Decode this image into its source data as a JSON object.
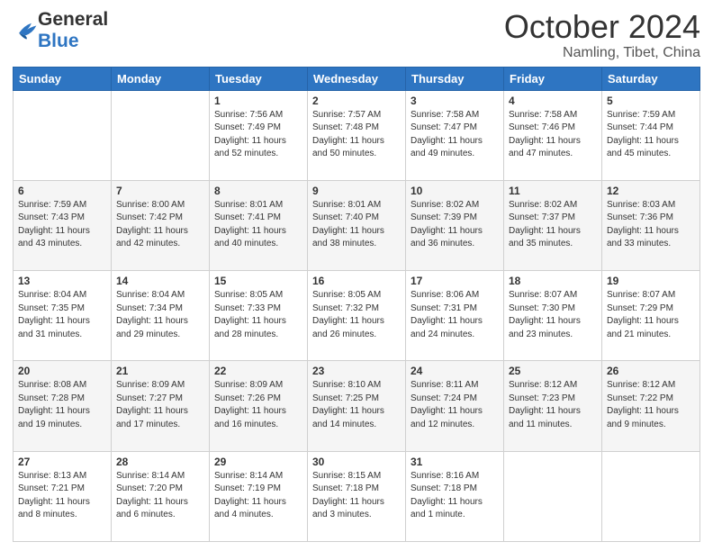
{
  "header": {
    "logo_line1": "General",
    "logo_line2": "Blue",
    "title": "October 2024",
    "location": "Namling, Tibet, China"
  },
  "weekdays": [
    "Sunday",
    "Monday",
    "Tuesday",
    "Wednesday",
    "Thursday",
    "Friday",
    "Saturday"
  ],
  "weeks": [
    [
      {
        "day": "",
        "sunrise": "",
        "sunset": "",
        "daylight": ""
      },
      {
        "day": "",
        "sunrise": "",
        "sunset": "",
        "daylight": ""
      },
      {
        "day": "1",
        "sunrise": "Sunrise: 7:56 AM",
        "sunset": "Sunset: 7:49 PM",
        "daylight": "Daylight: 11 hours and 52 minutes."
      },
      {
        "day": "2",
        "sunrise": "Sunrise: 7:57 AM",
        "sunset": "Sunset: 7:48 PM",
        "daylight": "Daylight: 11 hours and 50 minutes."
      },
      {
        "day": "3",
        "sunrise": "Sunrise: 7:58 AM",
        "sunset": "Sunset: 7:47 PM",
        "daylight": "Daylight: 11 hours and 49 minutes."
      },
      {
        "day": "4",
        "sunrise": "Sunrise: 7:58 AM",
        "sunset": "Sunset: 7:46 PM",
        "daylight": "Daylight: 11 hours and 47 minutes."
      },
      {
        "day": "5",
        "sunrise": "Sunrise: 7:59 AM",
        "sunset": "Sunset: 7:44 PM",
        "daylight": "Daylight: 11 hours and 45 minutes."
      }
    ],
    [
      {
        "day": "6",
        "sunrise": "Sunrise: 7:59 AM",
        "sunset": "Sunset: 7:43 PM",
        "daylight": "Daylight: 11 hours and 43 minutes."
      },
      {
        "day": "7",
        "sunrise": "Sunrise: 8:00 AM",
        "sunset": "Sunset: 7:42 PM",
        "daylight": "Daylight: 11 hours and 42 minutes."
      },
      {
        "day": "8",
        "sunrise": "Sunrise: 8:01 AM",
        "sunset": "Sunset: 7:41 PM",
        "daylight": "Daylight: 11 hours and 40 minutes."
      },
      {
        "day": "9",
        "sunrise": "Sunrise: 8:01 AM",
        "sunset": "Sunset: 7:40 PM",
        "daylight": "Daylight: 11 hours and 38 minutes."
      },
      {
        "day": "10",
        "sunrise": "Sunrise: 8:02 AM",
        "sunset": "Sunset: 7:39 PM",
        "daylight": "Daylight: 11 hours and 36 minutes."
      },
      {
        "day": "11",
        "sunrise": "Sunrise: 8:02 AM",
        "sunset": "Sunset: 7:37 PM",
        "daylight": "Daylight: 11 hours and 35 minutes."
      },
      {
        "day": "12",
        "sunrise": "Sunrise: 8:03 AM",
        "sunset": "Sunset: 7:36 PM",
        "daylight": "Daylight: 11 hours and 33 minutes."
      }
    ],
    [
      {
        "day": "13",
        "sunrise": "Sunrise: 8:04 AM",
        "sunset": "Sunset: 7:35 PM",
        "daylight": "Daylight: 11 hours and 31 minutes."
      },
      {
        "day": "14",
        "sunrise": "Sunrise: 8:04 AM",
        "sunset": "Sunset: 7:34 PM",
        "daylight": "Daylight: 11 hours and 29 minutes."
      },
      {
        "day": "15",
        "sunrise": "Sunrise: 8:05 AM",
        "sunset": "Sunset: 7:33 PM",
        "daylight": "Daylight: 11 hours and 28 minutes."
      },
      {
        "day": "16",
        "sunrise": "Sunrise: 8:05 AM",
        "sunset": "Sunset: 7:32 PM",
        "daylight": "Daylight: 11 hours and 26 minutes."
      },
      {
        "day": "17",
        "sunrise": "Sunrise: 8:06 AM",
        "sunset": "Sunset: 7:31 PM",
        "daylight": "Daylight: 11 hours and 24 minutes."
      },
      {
        "day": "18",
        "sunrise": "Sunrise: 8:07 AM",
        "sunset": "Sunset: 7:30 PM",
        "daylight": "Daylight: 11 hours and 23 minutes."
      },
      {
        "day": "19",
        "sunrise": "Sunrise: 8:07 AM",
        "sunset": "Sunset: 7:29 PM",
        "daylight": "Daylight: 11 hours and 21 minutes."
      }
    ],
    [
      {
        "day": "20",
        "sunrise": "Sunrise: 8:08 AM",
        "sunset": "Sunset: 7:28 PM",
        "daylight": "Daylight: 11 hours and 19 minutes."
      },
      {
        "day": "21",
        "sunrise": "Sunrise: 8:09 AM",
        "sunset": "Sunset: 7:27 PM",
        "daylight": "Daylight: 11 hours and 17 minutes."
      },
      {
        "day": "22",
        "sunrise": "Sunrise: 8:09 AM",
        "sunset": "Sunset: 7:26 PM",
        "daylight": "Daylight: 11 hours and 16 minutes."
      },
      {
        "day": "23",
        "sunrise": "Sunrise: 8:10 AM",
        "sunset": "Sunset: 7:25 PM",
        "daylight": "Daylight: 11 hours and 14 minutes."
      },
      {
        "day": "24",
        "sunrise": "Sunrise: 8:11 AM",
        "sunset": "Sunset: 7:24 PM",
        "daylight": "Daylight: 11 hours and 12 minutes."
      },
      {
        "day": "25",
        "sunrise": "Sunrise: 8:12 AM",
        "sunset": "Sunset: 7:23 PM",
        "daylight": "Daylight: 11 hours and 11 minutes."
      },
      {
        "day": "26",
        "sunrise": "Sunrise: 8:12 AM",
        "sunset": "Sunset: 7:22 PM",
        "daylight": "Daylight: 11 hours and 9 minutes."
      }
    ],
    [
      {
        "day": "27",
        "sunrise": "Sunrise: 8:13 AM",
        "sunset": "Sunset: 7:21 PM",
        "daylight": "Daylight: 11 hours and 8 minutes."
      },
      {
        "day": "28",
        "sunrise": "Sunrise: 8:14 AM",
        "sunset": "Sunset: 7:20 PM",
        "daylight": "Daylight: 11 hours and 6 minutes."
      },
      {
        "day": "29",
        "sunrise": "Sunrise: 8:14 AM",
        "sunset": "Sunset: 7:19 PM",
        "daylight": "Daylight: 11 hours and 4 minutes."
      },
      {
        "day": "30",
        "sunrise": "Sunrise: 8:15 AM",
        "sunset": "Sunset: 7:18 PM",
        "daylight": "Daylight: 11 hours and 3 minutes."
      },
      {
        "day": "31",
        "sunrise": "Sunrise: 8:16 AM",
        "sunset": "Sunset: 7:18 PM",
        "daylight": "Daylight: 11 hours and 1 minute."
      },
      {
        "day": "",
        "sunrise": "",
        "sunset": "",
        "daylight": ""
      },
      {
        "day": "",
        "sunrise": "",
        "sunset": "",
        "daylight": ""
      }
    ]
  ]
}
